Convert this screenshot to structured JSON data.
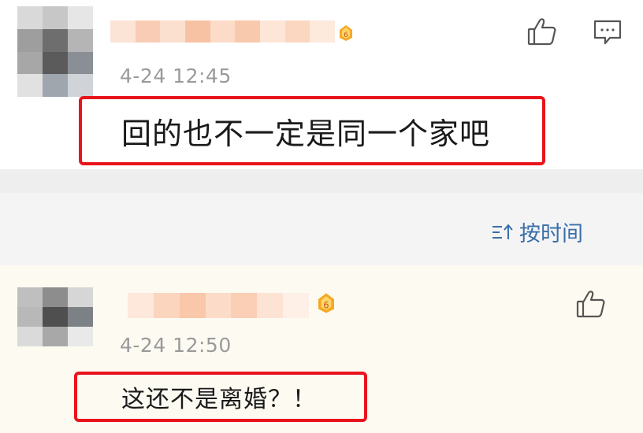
{
  "comments": [
    {
      "timestamp": "4-24 12:45",
      "content": "回的也不一定是同一个家吧",
      "has_reply_icon": true
    },
    {
      "timestamp": "4-24 12:50",
      "content": "这还不是离婚？！",
      "has_reply_icon": false
    }
  ],
  "sort": {
    "label": "按时间",
    "icon": "sort-icon"
  },
  "icons": {
    "like": "thumbs-up-icon",
    "reply": "comment-icon",
    "badge": "level-badge-icon"
  },
  "colors": {
    "highlight_border": "#e8141c",
    "link_blue": "#3a6ea8",
    "timestamp_gray": "#9a9a9a",
    "separator": "#eeeeef",
    "highlight_bg": "#fdfaf1"
  }
}
